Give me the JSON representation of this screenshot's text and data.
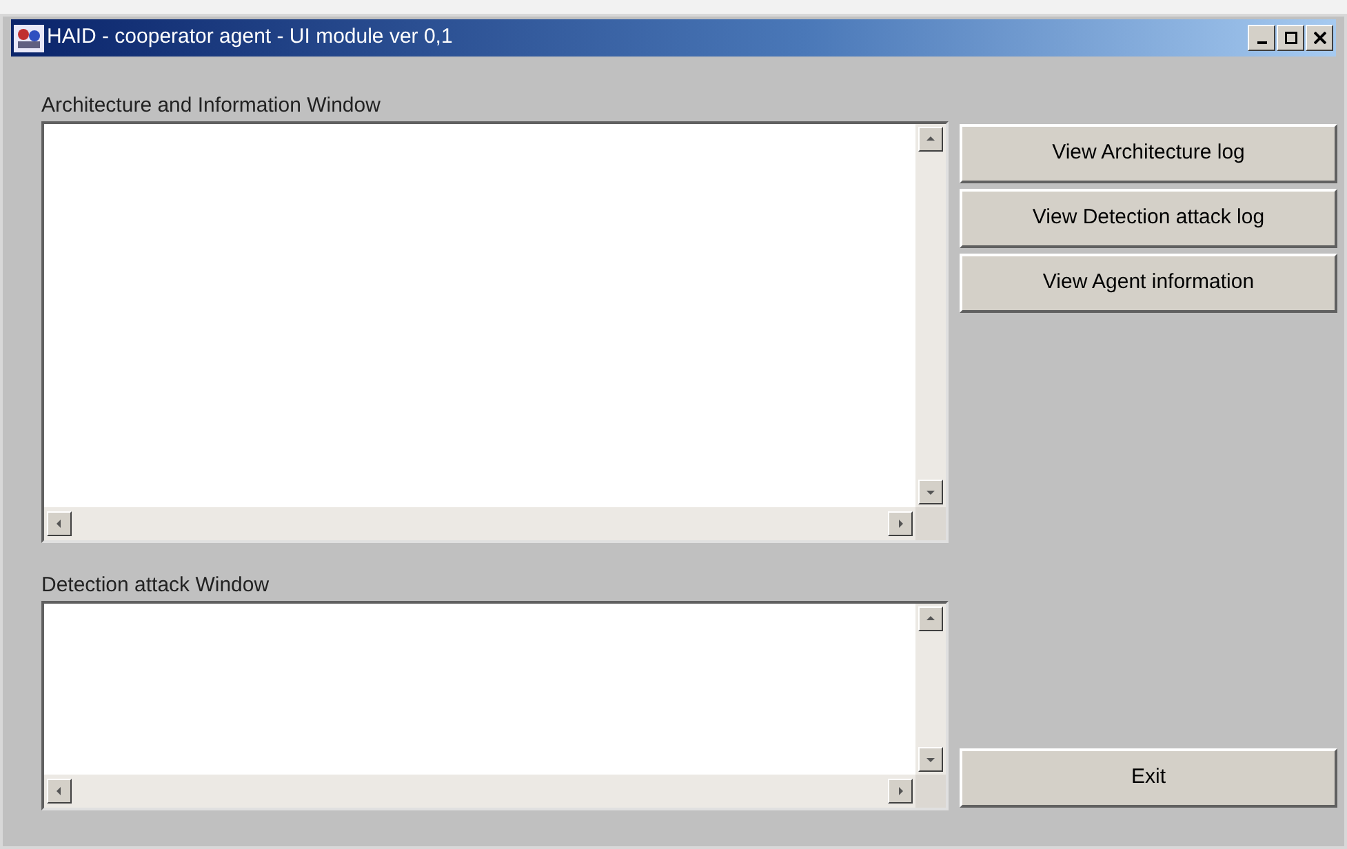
{
  "window": {
    "title": "HAID - cooperator agent - UI module ver 0,1"
  },
  "panes": [
    {
      "label": "Architecture and Information Window"
    },
    {
      "label": "Detection attack Window"
    }
  ],
  "buttons": [
    {
      "label": "View Architecture log"
    },
    {
      "label": "View Detection attack log"
    },
    {
      "label": "View Agent information"
    }
  ],
  "exit_button": {
    "label": "Exit"
  }
}
